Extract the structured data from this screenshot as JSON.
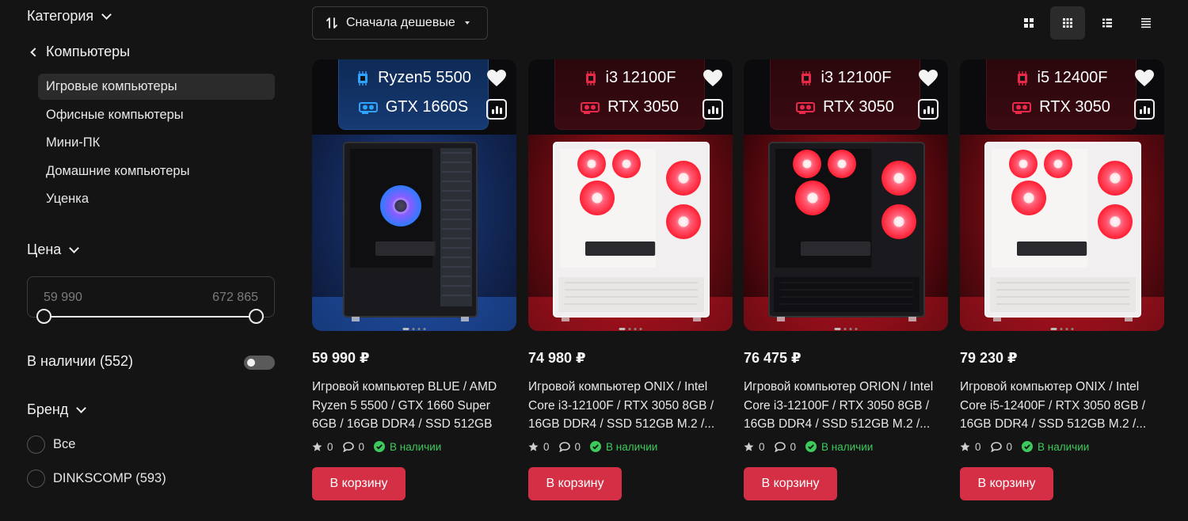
{
  "sidebar": {
    "category_title": "Категория",
    "parent_category": "Компьютеры",
    "categories": [
      {
        "label": "Игровые компьютеры",
        "active": true
      },
      {
        "label": "Офисные компьютеры",
        "active": false
      },
      {
        "label": "Мини-ПК",
        "active": false
      },
      {
        "label": "Домашние компьютеры",
        "active": false
      },
      {
        "label": "Уценка",
        "active": false
      }
    ],
    "price_title": "Цена",
    "price_min": "59 990",
    "price_max": "672 865",
    "in_stock_label": "В наличии (552)",
    "in_stock_enabled": false,
    "brand_title": "Бренд",
    "brands": [
      {
        "label": "Все"
      },
      {
        "label": "DINKSCOMP (593)"
      }
    ]
  },
  "toolbar": {
    "sort_label": "Сначала дешевые",
    "view_modes": [
      "grid-large-icon",
      "grid-small-icon",
      "list-icon",
      "list-compact-icon"
    ],
    "active_view": "grid-small-icon"
  },
  "products": [
    {
      "cpu": "Ryzen5 5500",
      "gpu": "GTX 1660S",
      "theme": "blue",
      "price": "59 990 ₽",
      "title": "Игровой компьютер BLUE / AMD Ryzen 5 5500 / GTX 1660 Super 6GB / 16GB DDR4 / SSD 512GB M....",
      "rating": "0",
      "reviews": "0",
      "stock": "В наличии",
      "cart_label": "В корзину"
    },
    {
      "cpu": "i3 12100F",
      "gpu": "RTX 3050",
      "theme": "white",
      "price": "74 980 ₽",
      "title": "Игровой компьютер ONIX / Intel Core i3-12100F / RTX 3050 8GB / 16GB DDR4 / SSD 512GB M.2 /...",
      "rating": "0",
      "reviews": "0",
      "stock": "В наличии",
      "cart_label": "В корзину"
    },
    {
      "cpu": "i3 12100F",
      "gpu": "RTX 3050",
      "theme": "black",
      "price": "76 475 ₽",
      "title": "Игровой компьютер ORION / Intel Core i3-12100F / RTX 3050 8GB / 16GB DDR4 / SSD 512GB M.2 /...",
      "rating": "0",
      "reviews": "0",
      "stock": "В наличии",
      "cart_label": "В корзину"
    },
    {
      "cpu": "i5 12400F",
      "gpu": "RTX 3050",
      "theme": "white",
      "price": "79 230 ₽",
      "title": "Игровой компьютер ONIX / Intel Core i5-12400F / RTX 3050 8GB / 16GB DDR4 / SSD 512GB M.2 /...",
      "rating": "0",
      "reviews": "0",
      "stock": "В наличии",
      "cart_label": "В корзину"
    }
  ],
  "colors": {
    "background": "#141414",
    "accent": "#d52f45",
    "stock_green": "#3ec95c",
    "spec_red": "#e8294a",
    "spec_blue": "#2ea3ff"
  }
}
